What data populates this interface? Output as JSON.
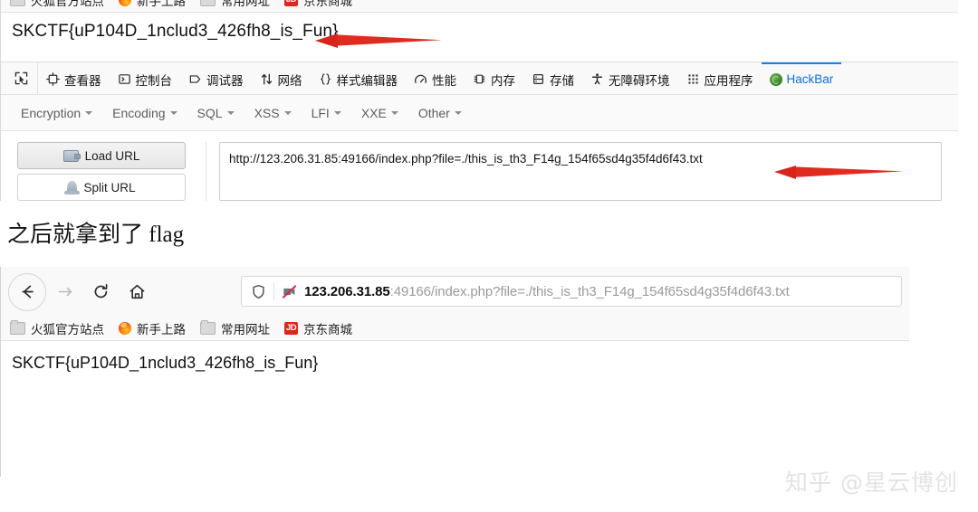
{
  "shot1": {
    "bookmarks_clipped": [
      {
        "label": "火狐官方站点",
        "icon": "folder-icon"
      },
      {
        "label": "新手上路",
        "icon": "firefox-icon"
      },
      {
        "label": "常用网址",
        "icon": "folder-icon"
      },
      {
        "label": "京东商城",
        "icon": "jd-icon",
        "icon_text": "JD"
      }
    ],
    "page_flag": "SKCTF{uP104D_1nclud3_426fh8_is_Fun}",
    "devtools": {
      "picker_icon": "element-picker-icon",
      "tabs": [
        {
          "label": "查看器",
          "icon": "inspector-icon",
          "active": false
        },
        {
          "label": "控制台",
          "icon": "console-icon",
          "active": false
        },
        {
          "label": "调试器",
          "icon": "debugger-icon",
          "active": false
        },
        {
          "label": "网络",
          "icon": "network-icon",
          "active": false
        },
        {
          "label": "样式编辑器",
          "icon": "style-editor-icon",
          "active": false
        },
        {
          "label": "性能",
          "icon": "performance-icon",
          "active": false
        },
        {
          "label": "内存",
          "icon": "memory-icon",
          "active": false
        },
        {
          "label": "存储",
          "icon": "storage-icon",
          "active": false
        },
        {
          "label": "无障碍环境",
          "icon": "accessibility-icon",
          "active": false
        },
        {
          "label": "应用程序",
          "icon": "application-icon",
          "active": false
        },
        {
          "label": "HackBar",
          "icon": "hackbar-icon",
          "active": true
        }
      ]
    },
    "hackbar": {
      "menu": [
        "Encryption",
        "Encoding",
        "SQL",
        "XSS",
        "LFI",
        "XXE",
        "Other"
      ],
      "load_url_label": "Load URL",
      "split_url_label": "Split URL",
      "url_value": "http://123.206.31.85:49166/index.php?file=./this_is_th3_F14g_154f65sd4g35f4d6f43.txt"
    }
  },
  "prose": "之后就拿到了 flag",
  "shot2": {
    "nav": {
      "back_icon": "back-arrow-icon",
      "forward_icon": "forward-arrow-icon",
      "reload_icon": "reload-icon",
      "home_icon": "home-icon"
    },
    "urlbar": {
      "shield_icon": "shield-icon",
      "permission_icon": "camera-blocked-icon",
      "host": "123.206.31.85",
      "path": ":49166/index.php?file=./this_is_th3_F14g_154f65sd4g35f4d6f43.txt"
    },
    "bookmarks": [
      {
        "label": "火狐官方站点",
        "icon": "folder-icon"
      },
      {
        "label": "新手上路",
        "icon": "firefox-icon"
      },
      {
        "label": "常用网址",
        "icon": "folder-icon"
      },
      {
        "label": "京东商城",
        "icon": "jd-icon",
        "icon_text": "JD"
      }
    ],
    "page_flag": "SKCTF{uP104D_1nclud3_426fh8_is_Fun}"
  },
  "annotations": {
    "arrow_color": "#e02b20",
    "arrow_1_target": "page flag text",
    "arrow_2_target": "hackbar url field"
  },
  "watermark": "知乎 @星云博创"
}
